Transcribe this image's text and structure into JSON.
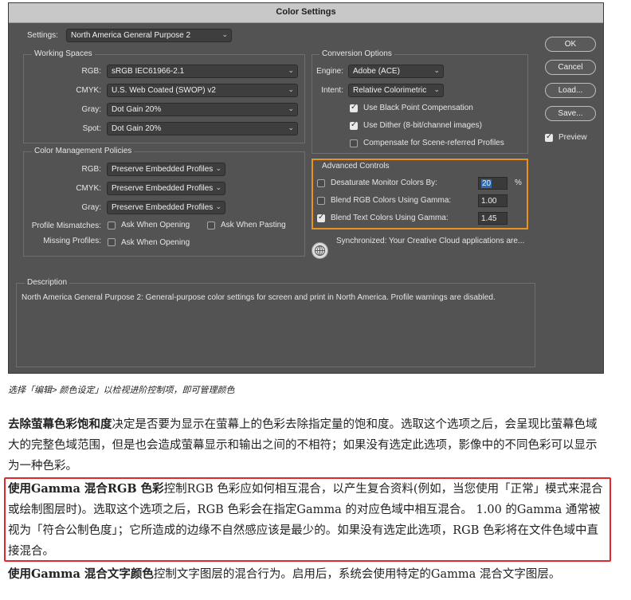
{
  "window": {
    "title": "Color Settings"
  },
  "settings": {
    "label": "Settings:",
    "value": "North America General Purpose 2"
  },
  "working_spaces": {
    "title": "Working Spaces",
    "rows": [
      {
        "label": "RGB:",
        "value": "sRGB IEC61966-2.1"
      },
      {
        "label": "CMYK:",
        "value": "U.S. Web Coated (SWOP) v2"
      },
      {
        "label": "Gray:",
        "value": "Dot Gain 20%"
      },
      {
        "label": "Spot:",
        "value": "Dot Gain 20%"
      }
    ]
  },
  "policies": {
    "title": "Color Management Policies",
    "rows": [
      {
        "label": "RGB:",
        "value": "Preserve Embedded Profiles"
      },
      {
        "label": "CMYK:",
        "value": "Preserve Embedded Profiles"
      },
      {
        "label": "Gray:",
        "value": "Preserve Embedded Profiles"
      }
    ],
    "mismatch_label": "Profile Mismatches:",
    "ask_opening": "Ask When Opening",
    "ask_pasting": "Ask When Pasting",
    "missing_label": "Missing Profiles:",
    "missing_ask_opening": "Ask When Opening"
  },
  "conversion": {
    "title": "Conversion Options",
    "engine_label": "Engine:",
    "engine_value": "Adobe (ACE)",
    "intent_label": "Intent:",
    "intent_value": "Relative Colorimetric",
    "black_point": "Use Black Point Compensation",
    "dither": "Use Dither (8-bit/channel images)",
    "scene": "Compensate for Scene-referred Profiles"
  },
  "advanced": {
    "title": "Advanced Controls",
    "desaturate": "Desaturate Monitor Colors By:",
    "desaturate_value": "20",
    "percent": "%",
    "blend_rgb": "Blend RGB Colors Using Gamma:",
    "blend_rgb_value": "1.00",
    "blend_text": "Blend Text Colors Using Gamma:",
    "blend_text_value": "1.45"
  },
  "sync_text": "Synchronized: Your Creative Cloud applications are...",
  "buttons": {
    "ok": "OK",
    "cancel": "Cancel",
    "load": "Load...",
    "save": "Save...",
    "preview": "Preview"
  },
  "description": {
    "title": "Description",
    "text": "North America General Purpose 2:  General-purpose color settings for screen and print in North America. Profile warnings are disabled."
  },
  "colors": {
    "highlight_orange": "#e8951f",
    "highlight_red": "#e3262c",
    "dialog_bg": "#535353",
    "link_blue": "#3b8fd9"
  },
  "caption": "选择「编辑> 颜色设定」以检视进阶控制项，即可管理颜色",
  "para1": {
    "bold": "去除萤幕色彩饱和度",
    "text": "决定是否要为显示在萤幕上的色彩去除指定量的饱和度。选取这个选项之后，会呈现比萤幕色域大的完整色域范围，但是也会造成萤幕显示和输出之间的不相符；如果没有选定此选项，影像中的不同色彩可以显示为一种色彩。"
  },
  "para2": {
    "bold": "使用Gamma 混合RGB 色彩",
    "text": "控制RGB 色彩应如何相互混合，以产生复合资料(例如，当您使用「正常」模式来混合或绘制图层时)。选取这个选项之后，RGB 色彩会在指定Gamma 的对应色域中相互混合。 1.00 的Gamma 通常被视为「符合公制色度」；它所造成的边缘不自然感应该是最少的。如果没有选定此选项，RGB 色彩将在文件色域中直接混合。"
  },
  "para3": {
    "bold": "使用Gamma 混合文字颜色",
    "text": "控制文字图层的混合行为。启用后，系统会使用特定的Gamma 混合文字图层。"
  }
}
